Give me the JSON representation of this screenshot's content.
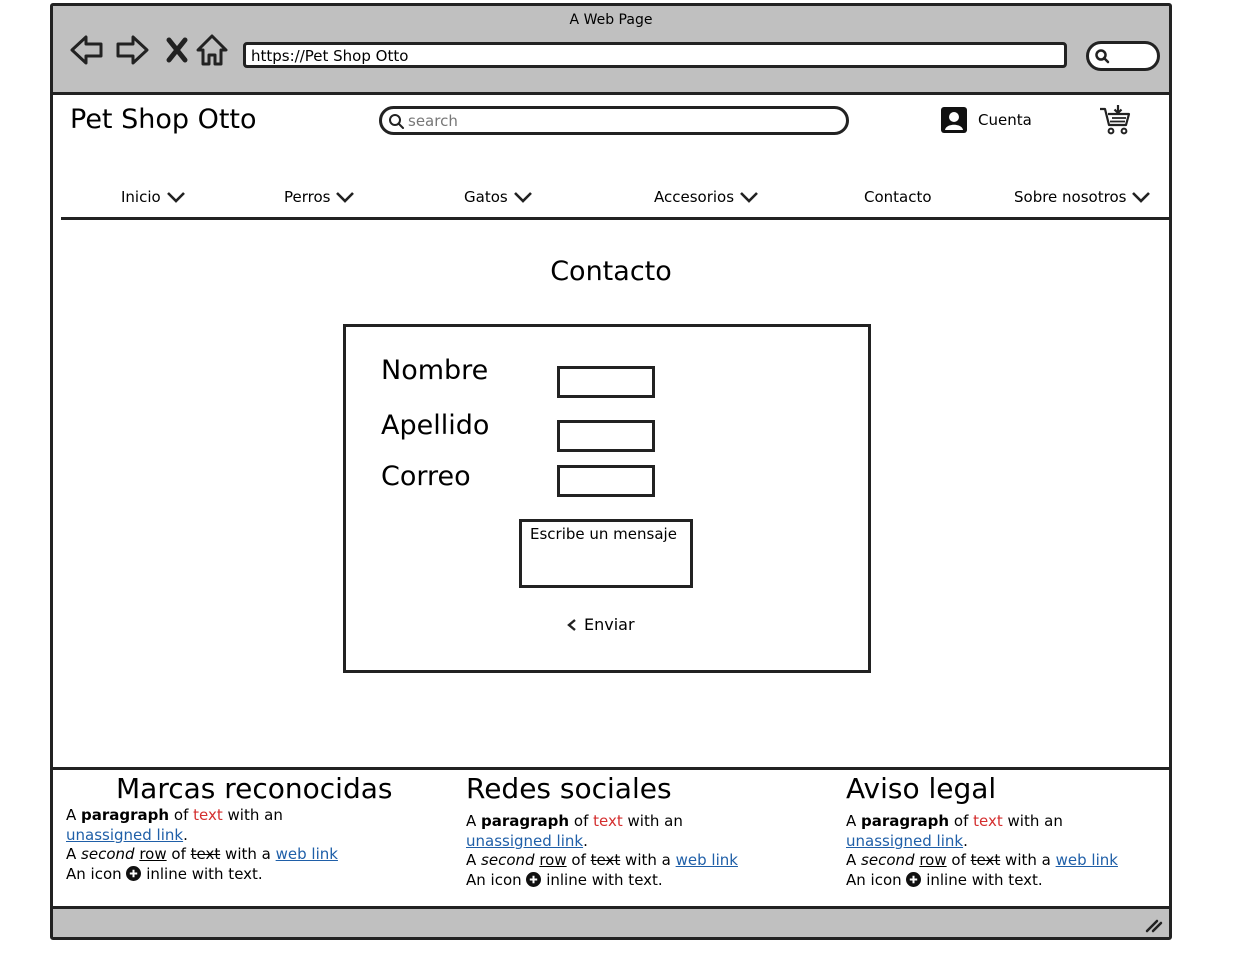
{
  "window": {
    "title": "A Web Page"
  },
  "browser": {
    "url": "https://Pet Shop Otto"
  },
  "site": {
    "title": "Pet Shop Otto",
    "search_placeholder": "search",
    "account_label": "Cuenta"
  },
  "menu": [
    {
      "label": "Inicio",
      "dropdown": true
    },
    {
      "label": "Perros",
      "dropdown": true
    },
    {
      "label": "Gatos",
      "dropdown": true
    },
    {
      "label": "Accesorios",
      "dropdown": true
    },
    {
      "label": "Contacto",
      "dropdown": false
    },
    {
      "label": "Sobre nosotros",
      "dropdown": true
    }
  ],
  "page": {
    "title": "Contacto"
  },
  "form": {
    "fields": [
      {
        "label": "Nombre",
        "value": ""
      },
      {
        "label": "Apellido",
        "value": ""
      },
      {
        "label": "Correo",
        "value": ""
      }
    ],
    "message_placeholder": "Escribe un mensaje",
    "submit_label": "Enviar"
  },
  "footer": {
    "columns": [
      {
        "heading": "Marcas reconocidas"
      },
      {
        "heading": "Redes sociales"
      },
      {
        "heading": "Aviso legal"
      }
    ],
    "text": {
      "a": "A",
      "paragraph": "paragraph",
      "of": "of",
      "text": "text",
      "with_an": "with an",
      "unassigned_link": "unassigned link",
      "period": ".",
      "second": "second",
      "row": "row",
      "with_a": "with a",
      "web_link": "web link",
      "an_icon": "An icon",
      "inline_with_text": "inline with text."
    }
  },
  "colors": {
    "chrome": "#c0c0c0",
    "link": "#1f5fa8",
    "red_text": "#d42f2f",
    "stroke": "#222222"
  }
}
